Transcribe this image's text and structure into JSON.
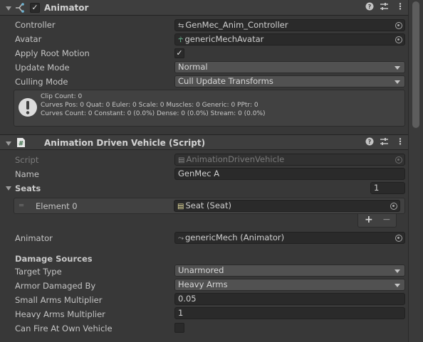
{
  "animator": {
    "title": "Animator",
    "enabled_check": "✓",
    "controller": {
      "label": "Controller",
      "value": "GenMec_Anim_Controller"
    },
    "avatar": {
      "label": "Avatar",
      "value": "genericMechAvatar"
    },
    "apply_root_motion": {
      "label": "Apply Root Motion",
      "check": "✓"
    },
    "update_mode": {
      "label": "Update Mode",
      "value": "Normal"
    },
    "culling_mode": {
      "label": "Culling Mode",
      "value": "Cull Update Transforms"
    },
    "info": {
      "line1": "Clip Count: 0",
      "line2": "Curves Pos: 0 Quat: 0 Euler: 0 Scale: 0 Muscles: 0 Generic: 0 PPtr: 0",
      "line3": "Curves Count: 0 Constant: 0 (0.0%) Dense: 0 (0.0%) Stream: 0 (0.0%)"
    }
  },
  "vehicle": {
    "title": "Animation Driven Vehicle (Script)",
    "script": {
      "label": "Script",
      "value": "AnimationDrivenVehicle"
    },
    "name": {
      "label": "Name",
      "value": "GenMec A"
    },
    "seats": {
      "label": "Seats",
      "count": "1",
      "element_label": "Element 0",
      "element_value": "Seat (Seat)",
      "add": "+",
      "remove": "−"
    },
    "animator": {
      "label": "Animator",
      "value": "genericMech (Animator)"
    },
    "damage_header": "Damage Sources",
    "target_type": {
      "label": "Target Type",
      "value": "Unarmored"
    },
    "armor_damaged_by": {
      "label": "Armor Damaged By",
      "value": "Heavy Arms"
    },
    "small_arms": {
      "label": "Small Arms Multiplier",
      "value": "0.05"
    },
    "heavy_arms": {
      "label": "Heavy Arms Multiplier",
      "value": "1"
    },
    "can_fire": {
      "label": "Can Fire At Own Vehicle"
    }
  },
  "colors": {
    "background": "#383838",
    "header": "#3e3e3e",
    "field": "#2a2a2a",
    "dropdown": "#515151",
    "text": "#c4c4c4"
  }
}
